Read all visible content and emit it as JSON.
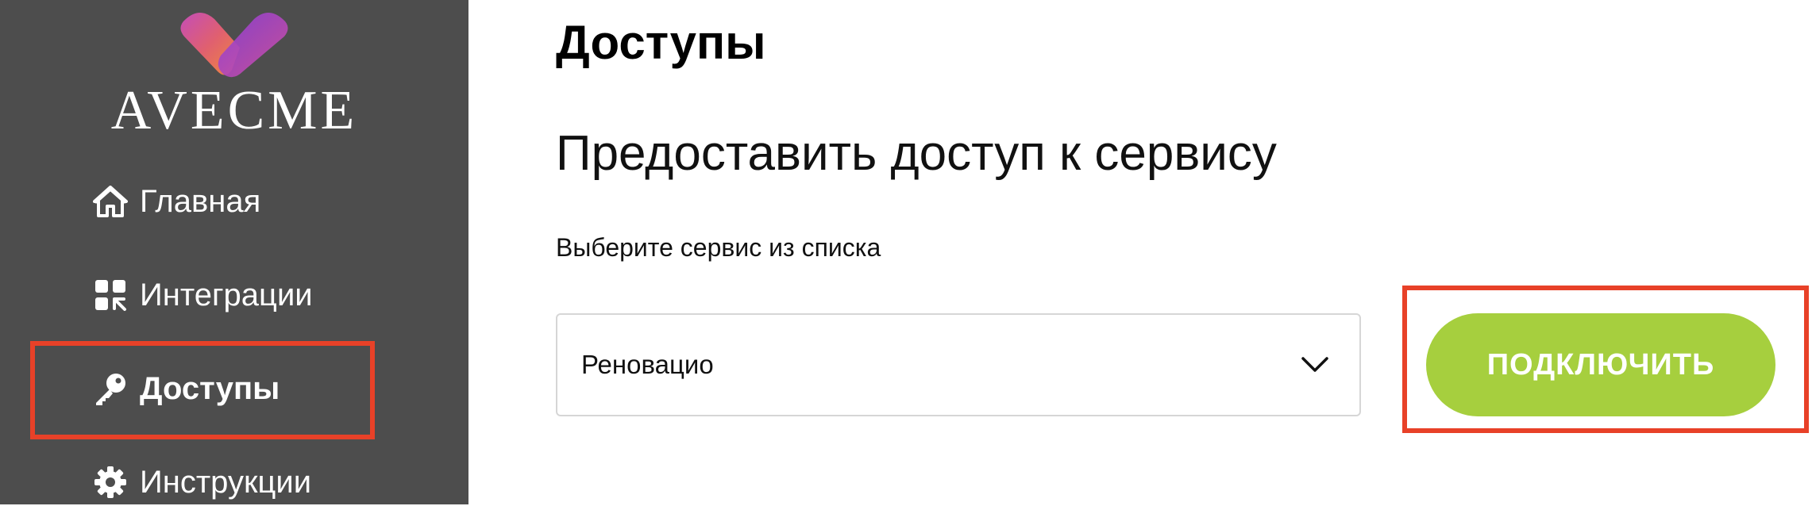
{
  "brand": {
    "name": "AVECME"
  },
  "sidebar": {
    "items": [
      {
        "label": "Главная",
        "icon": "home-icon"
      },
      {
        "label": "Интеграции",
        "icon": "integrations-icon"
      },
      {
        "label": "Доступы",
        "icon": "key-icon",
        "active": true
      },
      {
        "label": "Инструкции",
        "icon": "gear-icon"
      }
    ]
  },
  "main": {
    "title": "Доступы",
    "section_title": "Предоставить доступ к сервису",
    "select_label": "Выберите сервис из списка",
    "select_value": "Реновацио",
    "connect_button": "ПОДКЛЮЧИТЬ"
  },
  "colors": {
    "sidebar_bg": "#4d4d4d",
    "accent_button": "#a6cf3e",
    "highlight": "#e84128"
  }
}
